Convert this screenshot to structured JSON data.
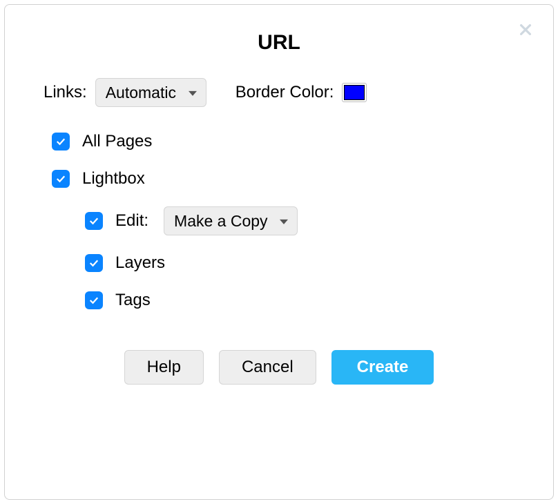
{
  "dialog": {
    "title": "URL",
    "links_label": "Links:",
    "links_value": "Automatic",
    "border_color_label": "Border Color:",
    "border_color_value": "#0000ff",
    "all_pages_label": "All Pages",
    "all_pages_checked": true,
    "lightbox_label": "Lightbox",
    "lightbox_checked": true,
    "edit_label": "Edit:",
    "edit_checked": true,
    "edit_value": "Make a Copy",
    "layers_label": "Layers",
    "layers_checked": true,
    "tags_label": "Tags",
    "tags_checked": true,
    "buttons": {
      "help": "Help",
      "cancel": "Cancel",
      "create": "Create"
    }
  }
}
